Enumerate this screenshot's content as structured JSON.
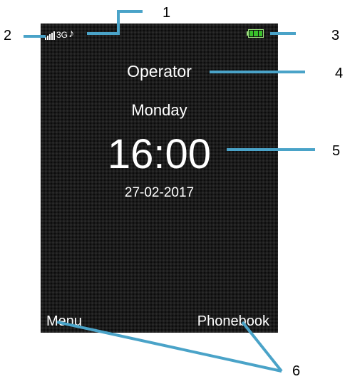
{
  "status_bar": {
    "network_type": "3G",
    "ringtone_symbol": "♪",
    "icons": [
      "signal-strength-icon",
      "music-note-icon",
      "battery-icon"
    ]
  },
  "home_screen": {
    "operator": "Operator",
    "day": "Monday",
    "time": "16:00",
    "date": "27-02-2017"
  },
  "softkeys": {
    "left": "Menu",
    "right": "Phonebook"
  },
  "callouts": [
    "1",
    "2",
    "3",
    "4",
    "5",
    "6"
  ],
  "colors": {
    "screen_background": "#1b1b1b",
    "callout_line": "#4aa3c8",
    "battery_fill": "#39c02b"
  }
}
